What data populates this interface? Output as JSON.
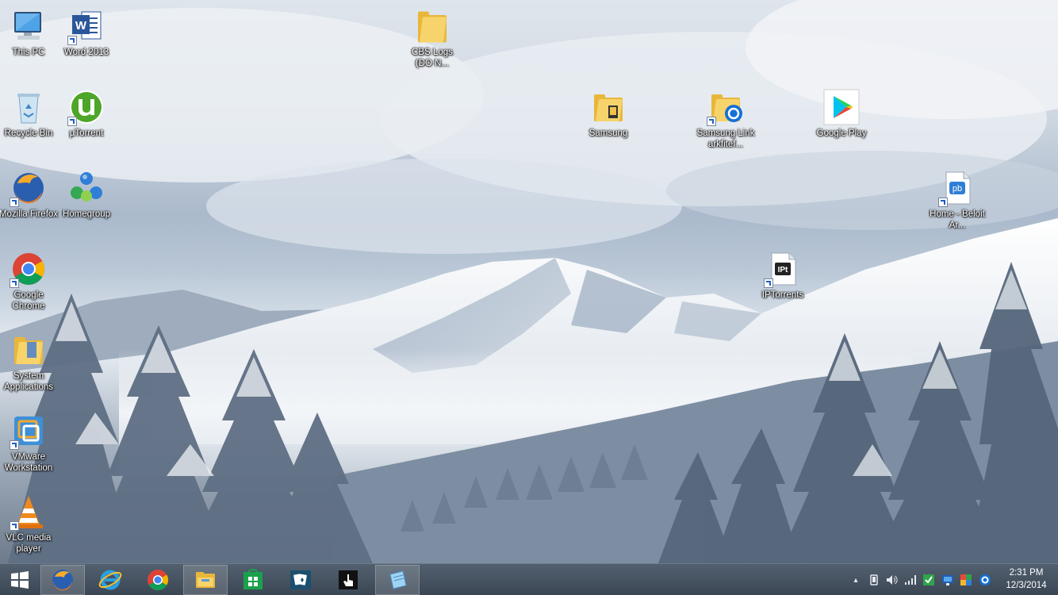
{
  "desktop": {
    "icons": [
      {
        "label": "This PC",
        "icon": "computer-icon"
      },
      {
        "label": "Word 2013",
        "icon": "word-icon"
      },
      {
        "label": "CBS Logs (DO N...",
        "icon": "folder-icon"
      },
      {
        "label": "Recycle Bin",
        "icon": "recycle-bin-icon"
      },
      {
        "label": "µTorrent",
        "icon": "utorrent-icon"
      },
      {
        "label": "Samsung",
        "icon": "folder-icon"
      },
      {
        "label": "Samsung Link arkfitef...",
        "icon": "samsung-link-icon"
      },
      {
        "label": "Google Play",
        "icon": "google-play-icon"
      },
      {
        "label": "Mozilla Firefox",
        "icon": "firefox-icon"
      },
      {
        "label": "Homegroup",
        "icon": "homegroup-icon"
      },
      {
        "label": "Home - Beloit Ar...",
        "icon": "web-shortcut-icon"
      },
      {
        "label": "Google Chrome",
        "icon": "chrome-icon"
      },
      {
        "label": "IPTorrents",
        "icon": "iptorrents-icon"
      },
      {
        "label": "System Applications",
        "icon": "folder-icon"
      },
      {
        "label": "VMware Workstation",
        "icon": "vmware-icon"
      },
      {
        "label": "VLC media player",
        "icon": "vlc-icon"
      }
    ],
    "glyph_text": {
      "word_letter": "W",
      "iptorrents": "IPt",
      "pb": "pb"
    }
  },
  "taskbar": {
    "buttons": [
      {
        "icon": "windows-start-icon"
      },
      {
        "icon": "firefox-icon"
      },
      {
        "icon": "internet-explorer-icon"
      },
      {
        "icon": "chrome-icon"
      },
      {
        "icon": "file-explorer-icon"
      },
      {
        "icon": "windows-store-icon"
      },
      {
        "icon": "solitaire-icon"
      },
      {
        "icon": "touch-icon"
      },
      {
        "icon": "notepad-icon"
      }
    ],
    "tray": {
      "overflow_glyph": "▴",
      "icons": [
        "device-icon",
        "volume-icon",
        "network-icon",
        "checkmark-icon",
        "monitor-icon",
        "color-palette-icon",
        "samsung-link-icon"
      ]
    },
    "clock": {
      "time": "2:31 PM",
      "date": "12/3/2014"
    }
  },
  "colors": {
    "taskbar_bg": "#46525f",
    "accent_blue": "#1f5fc4",
    "label_text": "#ffffff"
  }
}
